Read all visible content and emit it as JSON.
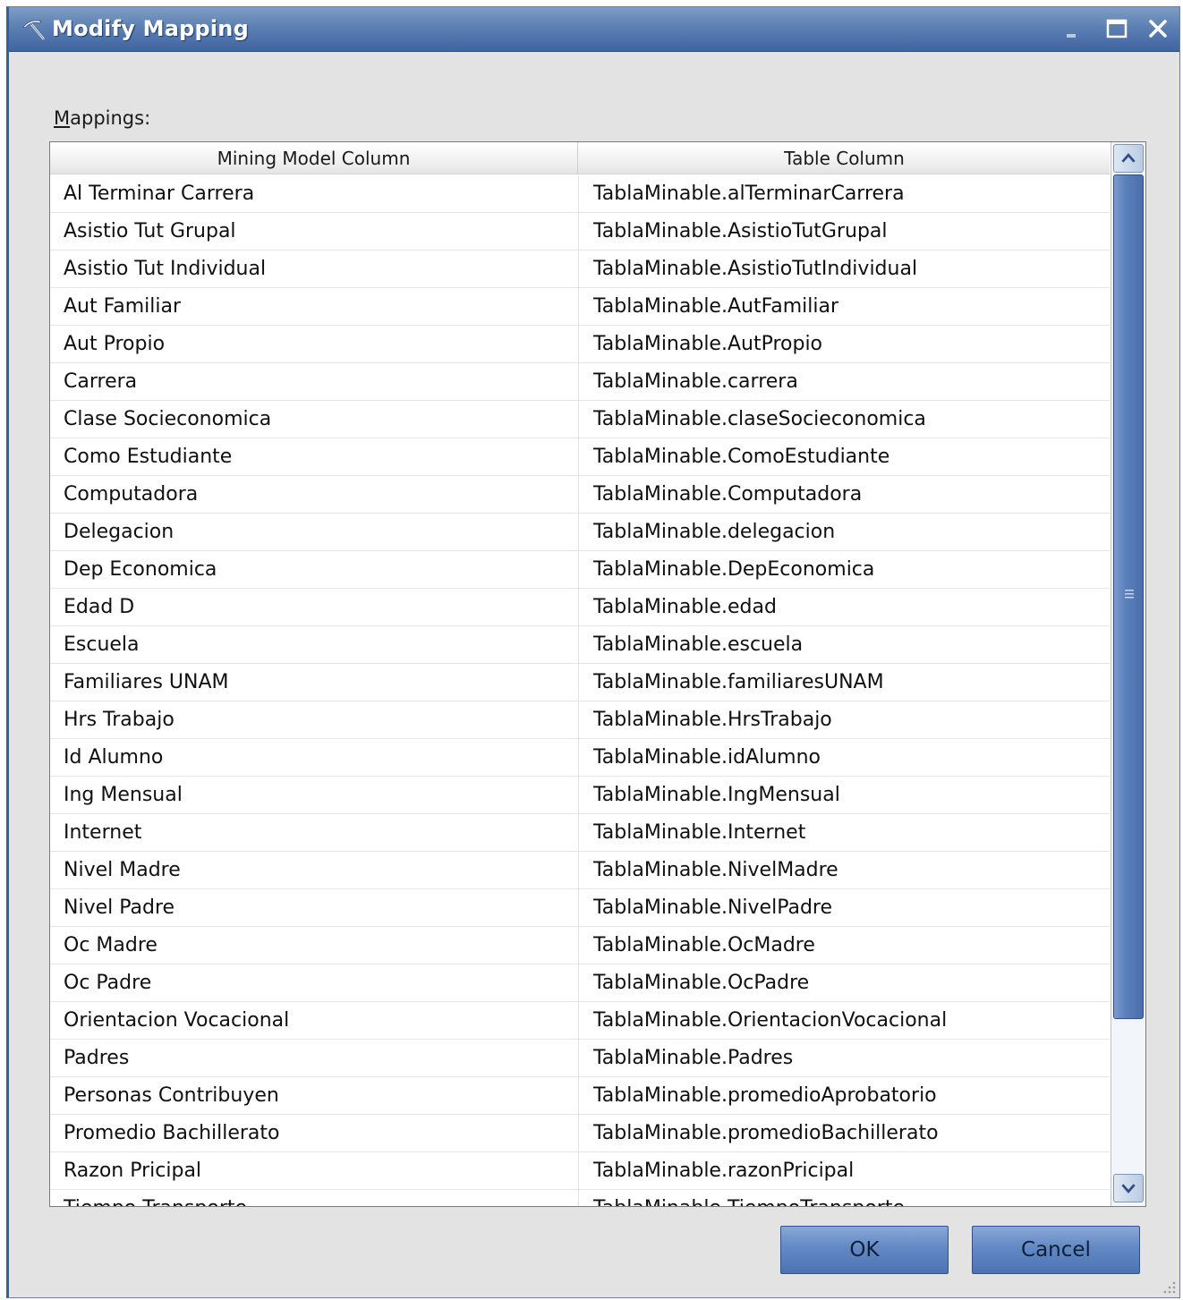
{
  "window": {
    "title": "Modify Mapping",
    "icon": "pickaxe-icon",
    "controls": [
      "minimize-icon",
      "maximize-icon",
      "close-icon"
    ]
  },
  "mappings_label_accel": "M",
  "mappings_label_rest": "appings:",
  "grid": {
    "columns": [
      "Mining Model Column",
      "Table Column"
    ],
    "rows": [
      [
        "Al Terminar Carrera",
        "TablaMinable.alTerminarCarrera"
      ],
      [
        "Asistio Tut Grupal",
        "TablaMinable.AsistioTutGrupal"
      ],
      [
        "Asistio Tut Individual",
        "TablaMinable.AsistioTutIndividual"
      ],
      [
        "Aut Familiar",
        "TablaMinable.AutFamiliar"
      ],
      [
        "Aut Propio",
        "TablaMinable.AutPropio"
      ],
      [
        "Carrera",
        "TablaMinable.carrera"
      ],
      [
        "Clase Socieconomica",
        "TablaMinable.claseSocieconomica"
      ],
      [
        "Como Estudiante",
        "TablaMinable.ComoEstudiante"
      ],
      [
        "Computadora",
        "TablaMinable.Computadora"
      ],
      [
        "Delegacion",
        "TablaMinable.delegacion"
      ],
      [
        "Dep Economica",
        "TablaMinable.DepEconomica"
      ],
      [
        "Edad D",
        "TablaMinable.edad"
      ],
      [
        "Escuela",
        "TablaMinable.escuela"
      ],
      [
        "Familiares UNAM",
        "TablaMinable.familiaresUNAM"
      ],
      [
        "Hrs Trabajo",
        "TablaMinable.HrsTrabajo"
      ],
      [
        "Id Alumno",
        "TablaMinable.idAlumno"
      ],
      [
        "Ing Mensual",
        "TablaMinable.IngMensual"
      ],
      [
        "Internet",
        "TablaMinable.Internet"
      ],
      [
        "Nivel Madre",
        "TablaMinable.NivelMadre"
      ],
      [
        "Nivel Padre",
        "TablaMinable.NivelPadre"
      ],
      [
        "Oc Madre",
        "TablaMinable.OcMadre"
      ],
      [
        "Oc Padre",
        "TablaMinable.OcPadre"
      ],
      [
        "Orientacion Vocacional",
        "TablaMinable.OrientacionVocacional"
      ],
      [
        "Padres",
        "TablaMinable.Padres"
      ],
      [
        "Personas Contribuyen",
        "TablaMinable.promedioAprobatorio"
      ],
      [
        "Promedio Bachillerato",
        "TablaMinable.promedioBachillerato"
      ],
      [
        "Razon Pricipal",
        "TablaMinable.razonPricipal"
      ],
      [
        "Tiempo Transporte",
        "TablaMinable.TiempoTransporte"
      ]
    ]
  },
  "buttons": {
    "ok": "OK",
    "cancel": "Cancel"
  },
  "colors": {
    "titlebar": "#5d80b4",
    "button": "#6289c4",
    "scroll_thumb": "#5b80bb"
  }
}
